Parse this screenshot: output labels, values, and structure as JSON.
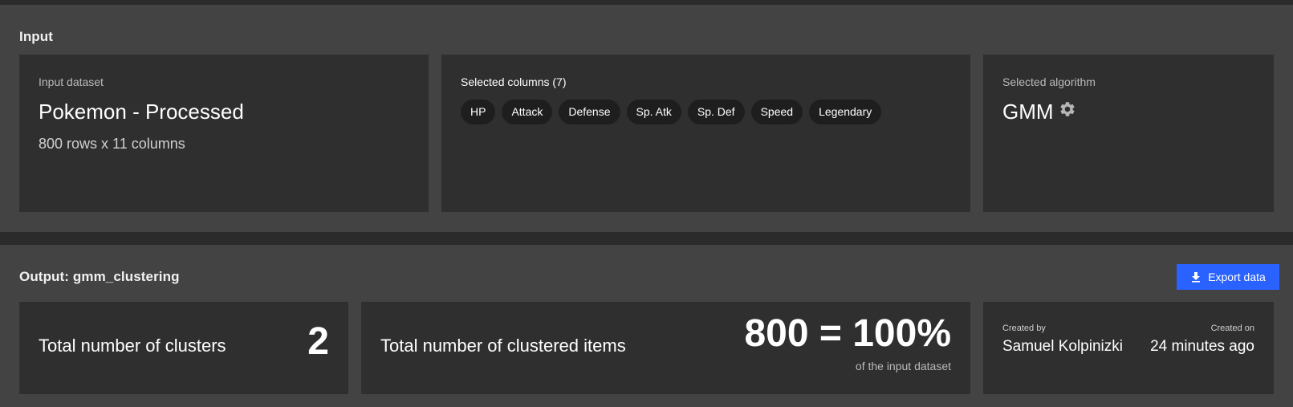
{
  "input": {
    "title": "Input",
    "dataset": {
      "label": "Input dataset",
      "name": "Pokemon - Processed",
      "size": "800 rows x 11 columns"
    },
    "columns": {
      "label": "Selected columns (7)",
      "items": [
        "HP",
        "Attack",
        "Defense",
        "Sp. Atk",
        "Sp. Def",
        "Speed",
        "Legendary"
      ]
    },
    "algorithm": {
      "label": "Selected algorithm",
      "name": "GMM",
      "settings_icon": "gear-icon"
    }
  },
  "output": {
    "title": "Output: gmm_clustering",
    "export_label": "Export data",
    "export_icon": "download-icon",
    "clusters": {
      "label": "Total number of clusters",
      "value": "2"
    },
    "items": {
      "label": "Total number of clustered items",
      "value": "800 = 100%",
      "sub": "of the input dataset"
    },
    "meta": {
      "created_by_label": "Created by",
      "created_by": "Samuel Kolpinizki",
      "created_on_label": "Created on",
      "created_on": "24 minutes ago"
    }
  },
  "colors": {
    "page_bg": "#2b2b2b",
    "section_bg": "#434343",
    "card_bg": "#2f2f2f",
    "chip_bg": "#1e1e1e",
    "accent": "#2962ff"
  }
}
